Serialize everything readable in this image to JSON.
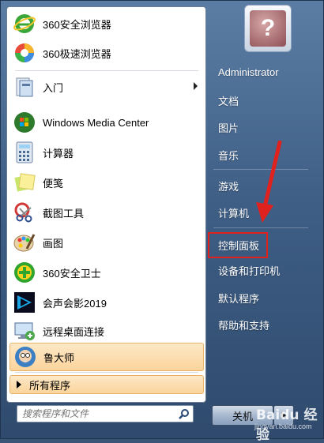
{
  "pinned_programs": [
    {
      "label": "360安全浏览器",
      "icon": "360-browser-icon"
    },
    {
      "label": "360极速浏览器",
      "icon": "360-speed-browser-icon"
    }
  ],
  "recent_programs": [
    {
      "label": "入门",
      "icon": "getting-started-icon",
      "has_submenu": true
    },
    {
      "label": "Windows Media Center",
      "icon": "windows-media-center-icon"
    },
    {
      "label": "计算器",
      "icon": "calculator-icon"
    },
    {
      "label": "便笺",
      "icon": "sticky-notes-icon"
    },
    {
      "label": "截图工具",
      "icon": "snipping-tool-icon"
    },
    {
      "label": "画图",
      "icon": "paint-icon"
    },
    {
      "label": "360安全卫士",
      "icon": "360-security-icon"
    },
    {
      "label": "会声会影2019",
      "icon": "videostudio-icon"
    },
    {
      "label": "远程桌面连接",
      "icon": "remote-desktop-icon"
    },
    {
      "label": "鲁大师",
      "icon": "ludashi-icon",
      "highlighted": true
    }
  ],
  "all_programs_label": "所有程序",
  "search": {
    "placeholder": "搜索程序和文件"
  },
  "right_pane": {
    "user_name": "Administrator",
    "items": [
      {
        "label": "文档"
      },
      {
        "label": "图片"
      },
      {
        "label": "音乐"
      },
      {
        "label": "游戏"
      },
      {
        "label": "计算机"
      },
      {
        "label": "控制面板",
        "annotated": true
      },
      {
        "label": "设备和打印机"
      },
      {
        "label": "默认程序"
      },
      {
        "label": "帮助和支持"
      }
    ]
  },
  "shutdown_label": "关机",
  "user_tile_glyph": "?",
  "watermark": {
    "main": "Baidu 经验",
    "sub": "jingyan.baidu.com"
  },
  "colors": {
    "annotation_red": "#e0221f",
    "highlight": "#fbd49b"
  }
}
